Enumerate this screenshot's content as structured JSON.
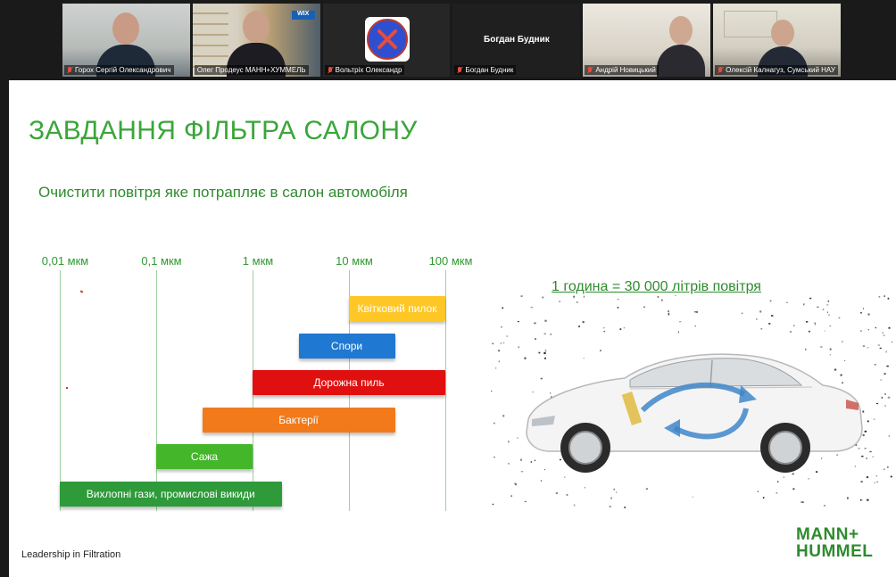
{
  "participants": [
    {
      "name": "Горох Сергій Олександрович",
      "muted": true,
      "type": "video"
    },
    {
      "name": "Олег Продеус МАНН+ХУММЕЛЬ",
      "muted": false,
      "type": "video",
      "active": true
    },
    {
      "name": "Вольтріх Олександр",
      "muted": true,
      "type": "avatar"
    },
    {
      "name": "Богдан Будник",
      "muted": true,
      "type": "name-only",
      "display_name": "Богдан Будник"
    },
    {
      "name": "Андрій Новицький",
      "muted": true,
      "type": "video"
    },
    {
      "name": "Олексій Калнагуз, Сумський НАУ",
      "muted": true,
      "type": "video"
    }
  ],
  "slide": {
    "title": "ЗАВДАННЯ ФІЛЬТРА САЛОНУ",
    "subtitle": "Очистити повітря яке потрапляє в салон автомобіля",
    "scale_labels": [
      "0,01 мкм",
      "0,1 мкм",
      "1 мкм",
      "10 мкм",
      "100 мкм"
    ],
    "particles": [
      {
        "label": "Квітковий пилок",
        "from": 10,
        "to": 100,
        "color": "#ffc726"
      },
      {
        "label": "Спори",
        "from": 3,
        "to": 30,
        "color": "#1f78d1"
      },
      {
        "label": "Дорожна пиль",
        "from": 1,
        "to": 100,
        "color": "#e01010"
      },
      {
        "label": "Бактерії",
        "from": 0.3,
        "to": 30,
        "color": "#f27a1a"
      },
      {
        "label": "Сажа",
        "from": 0.1,
        "to": 1,
        "color": "#44b62a"
      },
      {
        "label": "Вихлопні гази, промислові викиди",
        "from": 0.01,
        "to": 2,
        "color": "#2e9a3a"
      }
    ],
    "air_rate": "1 година = 30 000 літрів повітря",
    "footer": "Leadership in Filtration",
    "logo_line1": "MANN+",
    "logo_line2": "HUMMEL"
  }
}
